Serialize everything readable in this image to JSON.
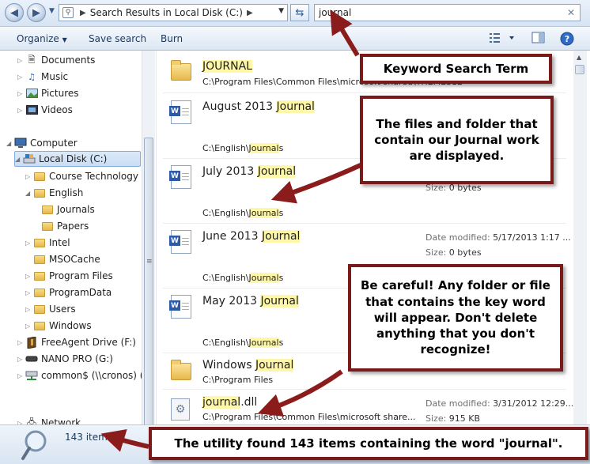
{
  "address": {
    "path_label": "Search Results in Local Disk (C:)",
    "search_value": "journal"
  },
  "toolbar": {
    "organize": "Organize",
    "save_search": "Save search",
    "burn": "Burn"
  },
  "nav": {
    "items": [
      {
        "label": "Documents"
      },
      {
        "label": "Music"
      },
      {
        "label": "Pictures"
      },
      {
        "label": "Videos"
      },
      {
        "label": "Computer"
      },
      {
        "label": "Local Disk (C:)"
      },
      {
        "label": "Course Technology"
      },
      {
        "label": "English"
      },
      {
        "label": "Journals"
      },
      {
        "label": "Papers"
      },
      {
        "label": "Intel"
      },
      {
        "label": "MSOCache"
      },
      {
        "label": "Program Files"
      },
      {
        "label": "ProgramData"
      },
      {
        "label": "Users"
      },
      {
        "label": "Windows"
      },
      {
        "label": "FreeAgent Drive (F:)"
      },
      {
        "label": "NANO PRO (G:)"
      },
      {
        "label": "common$ (\\\\cronos) (C"
      },
      {
        "label": "Network"
      }
    ]
  },
  "results": [
    {
      "name_pre": "",
      "name_hl": "JOURNAL",
      "name_post": "",
      "path_pre": "C:\\Program Files\\Common Files\\microsoft shared\\THEMES12",
      "path_hl": "",
      "path_post": ""
    },
    {
      "name_pre": "August 2013 ",
      "name_hl": "Journal",
      "name_post": "",
      "path_pre": "C:\\English\\",
      "path_hl": "Journal",
      "path_post": "s"
    },
    {
      "name_pre": "July 2013 ",
      "name_hl": "Journal",
      "name_post": "",
      "path_pre": "C:\\English\\",
      "path_hl": "Journal",
      "path_post": "s",
      "size_label": "Size:",
      "size": "0 bytes"
    },
    {
      "name_pre": "June 2013 ",
      "name_hl": "Journal",
      "name_post": "",
      "path_pre": "C:\\English\\",
      "path_hl": "Journal",
      "path_post": "s",
      "date_label": "Date modified:",
      "date": "5/17/2013 1:17 ...",
      "size_label": "Size:",
      "size": "0 bytes"
    },
    {
      "name_pre": "May 2013 ",
      "name_hl": "Journal",
      "name_post": "",
      "path_pre": "C:\\English\\",
      "path_hl": "Journal",
      "path_post": "s"
    },
    {
      "name_pre": "Windows ",
      "name_hl": "Journal",
      "name_post": "",
      "path_pre": "C:\\Program Files",
      "path_hl": "",
      "path_post": ""
    },
    {
      "name_pre": "",
      "name_hl": "journal",
      "name_post": ".dll",
      "path_pre": "C:\\Program Files\\Common Files\\microsoft share...",
      "path_hl": "",
      "path_post": "",
      "date_label": "Date modified:",
      "date": "3/31/2012 12:29...",
      "size_label": "Size:",
      "size": "915 KB"
    }
  ],
  "status": {
    "count": "143 items"
  },
  "callouts": {
    "keyword": "Keyword Search Term",
    "files": "The files and folder that contain our Journal work are displayed.",
    "careful": "Be careful! Any folder or file that contains the key word will appear.  Don't delete anything that you don't recognize!",
    "utility": "The utility found 143 items containing the word \"journal\"."
  },
  "colors": {
    "highlight": "#fff7a8",
    "callout_border": "#7a1a1a",
    "arrow": "#8b1c1c"
  }
}
